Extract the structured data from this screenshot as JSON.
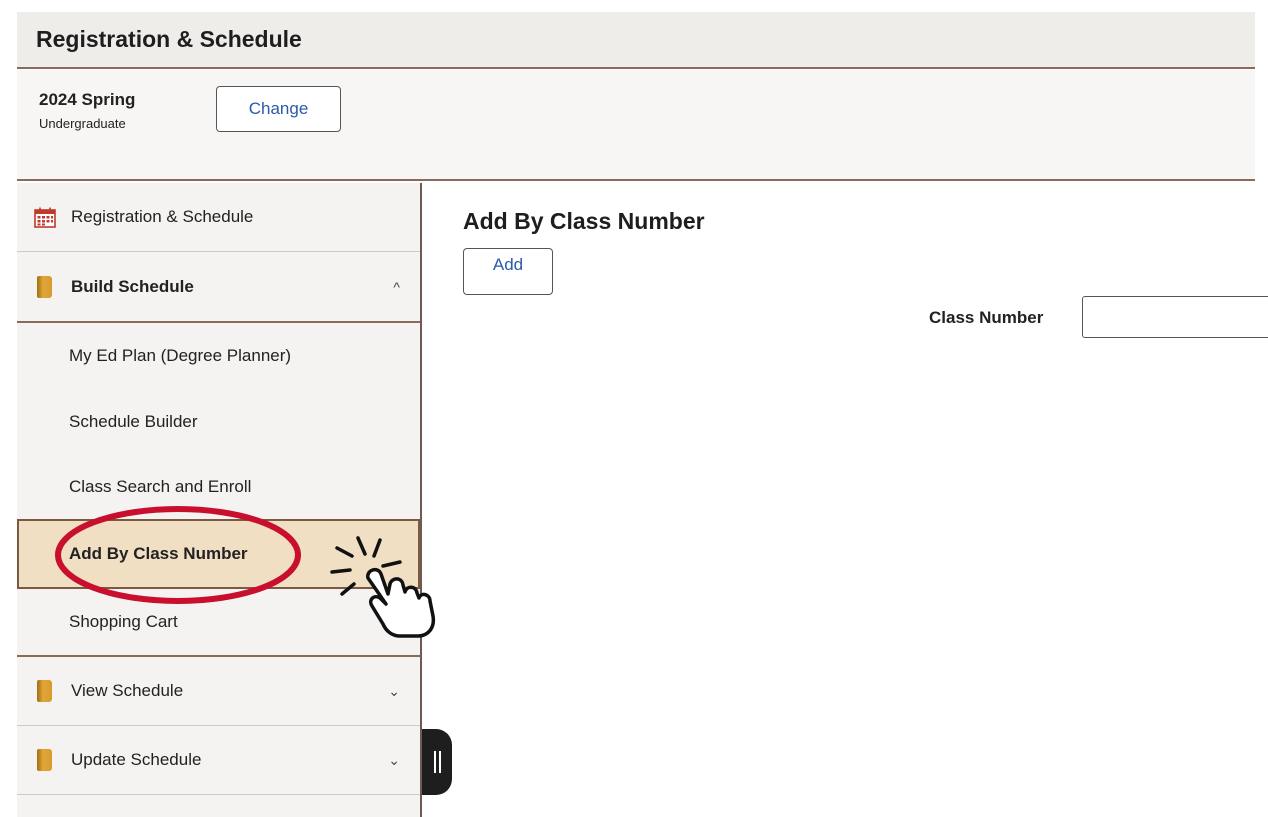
{
  "header": {
    "title": "Registration & Schedule"
  },
  "term": {
    "name": "2024 Spring",
    "career": "Undergraduate",
    "change_label": "Change"
  },
  "sidebar": {
    "items": [
      {
        "label": "Registration & Schedule",
        "icon": "calendar-icon"
      },
      {
        "label": "Build Schedule",
        "icon": "book-icon",
        "expanded": true
      },
      {
        "label": "My Ed Plan (Degree Planner)"
      },
      {
        "label": "Schedule Builder"
      },
      {
        "label": "Class Search and Enroll"
      },
      {
        "label": "Add By Class Number",
        "selected": true
      },
      {
        "label": "Shopping Cart"
      },
      {
        "label": "View Schedule",
        "icon": "book-icon",
        "expanded": false
      },
      {
        "label": "Update Schedule",
        "icon": "book-icon",
        "expanded": false
      }
    ],
    "chevron_up": "^",
    "chevron_down": "⌄"
  },
  "main": {
    "title": "Add By Class Number",
    "add_label": "Add",
    "class_number_label": "Class Number",
    "class_number_value": ""
  },
  "colors": {
    "accent_border": "#8a6a5a",
    "selected_bg": "#f1dfc4",
    "link_blue": "#2b5aa8",
    "annotation_red": "#c8102e"
  }
}
